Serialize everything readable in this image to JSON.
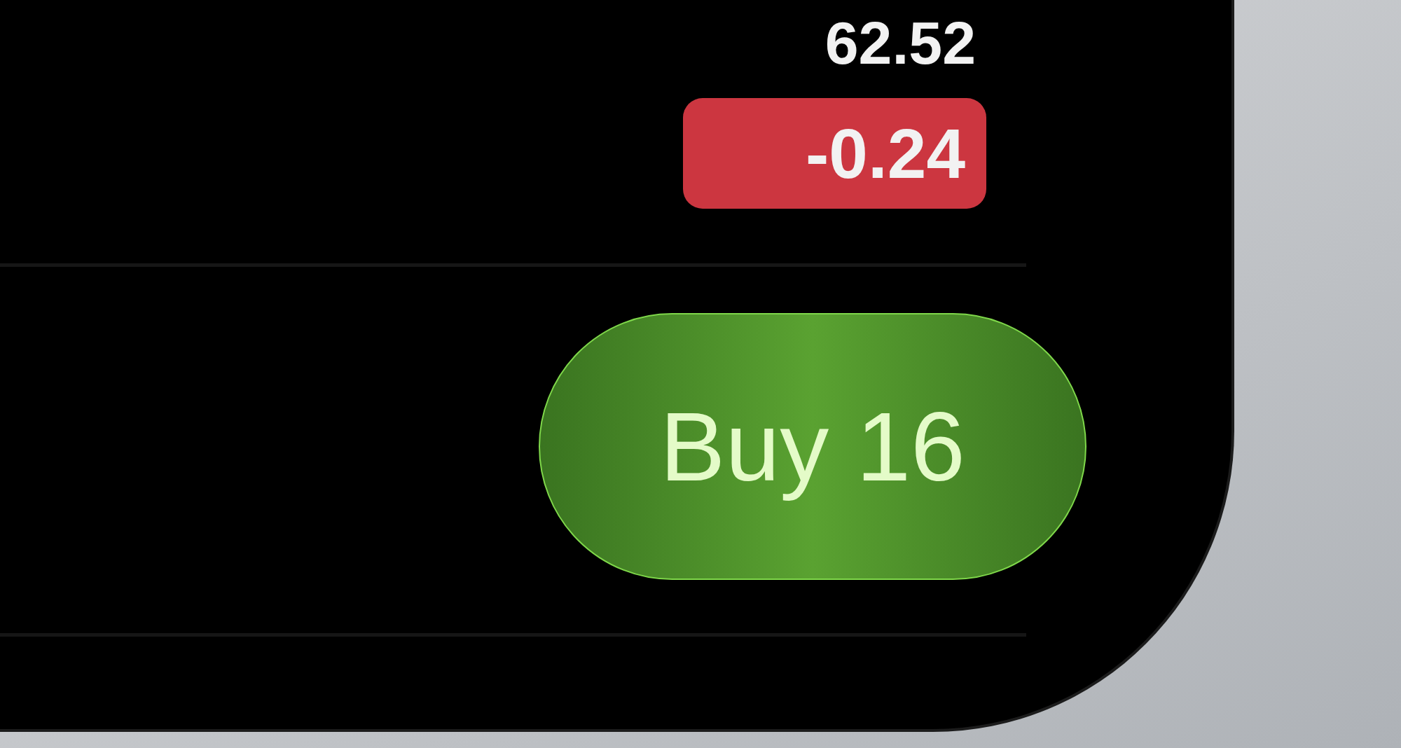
{
  "quote": {
    "price": "62.52",
    "change": "-0.24",
    "negative": true
  },
  "action": {
    "label": "Buy 16"
  }
}
